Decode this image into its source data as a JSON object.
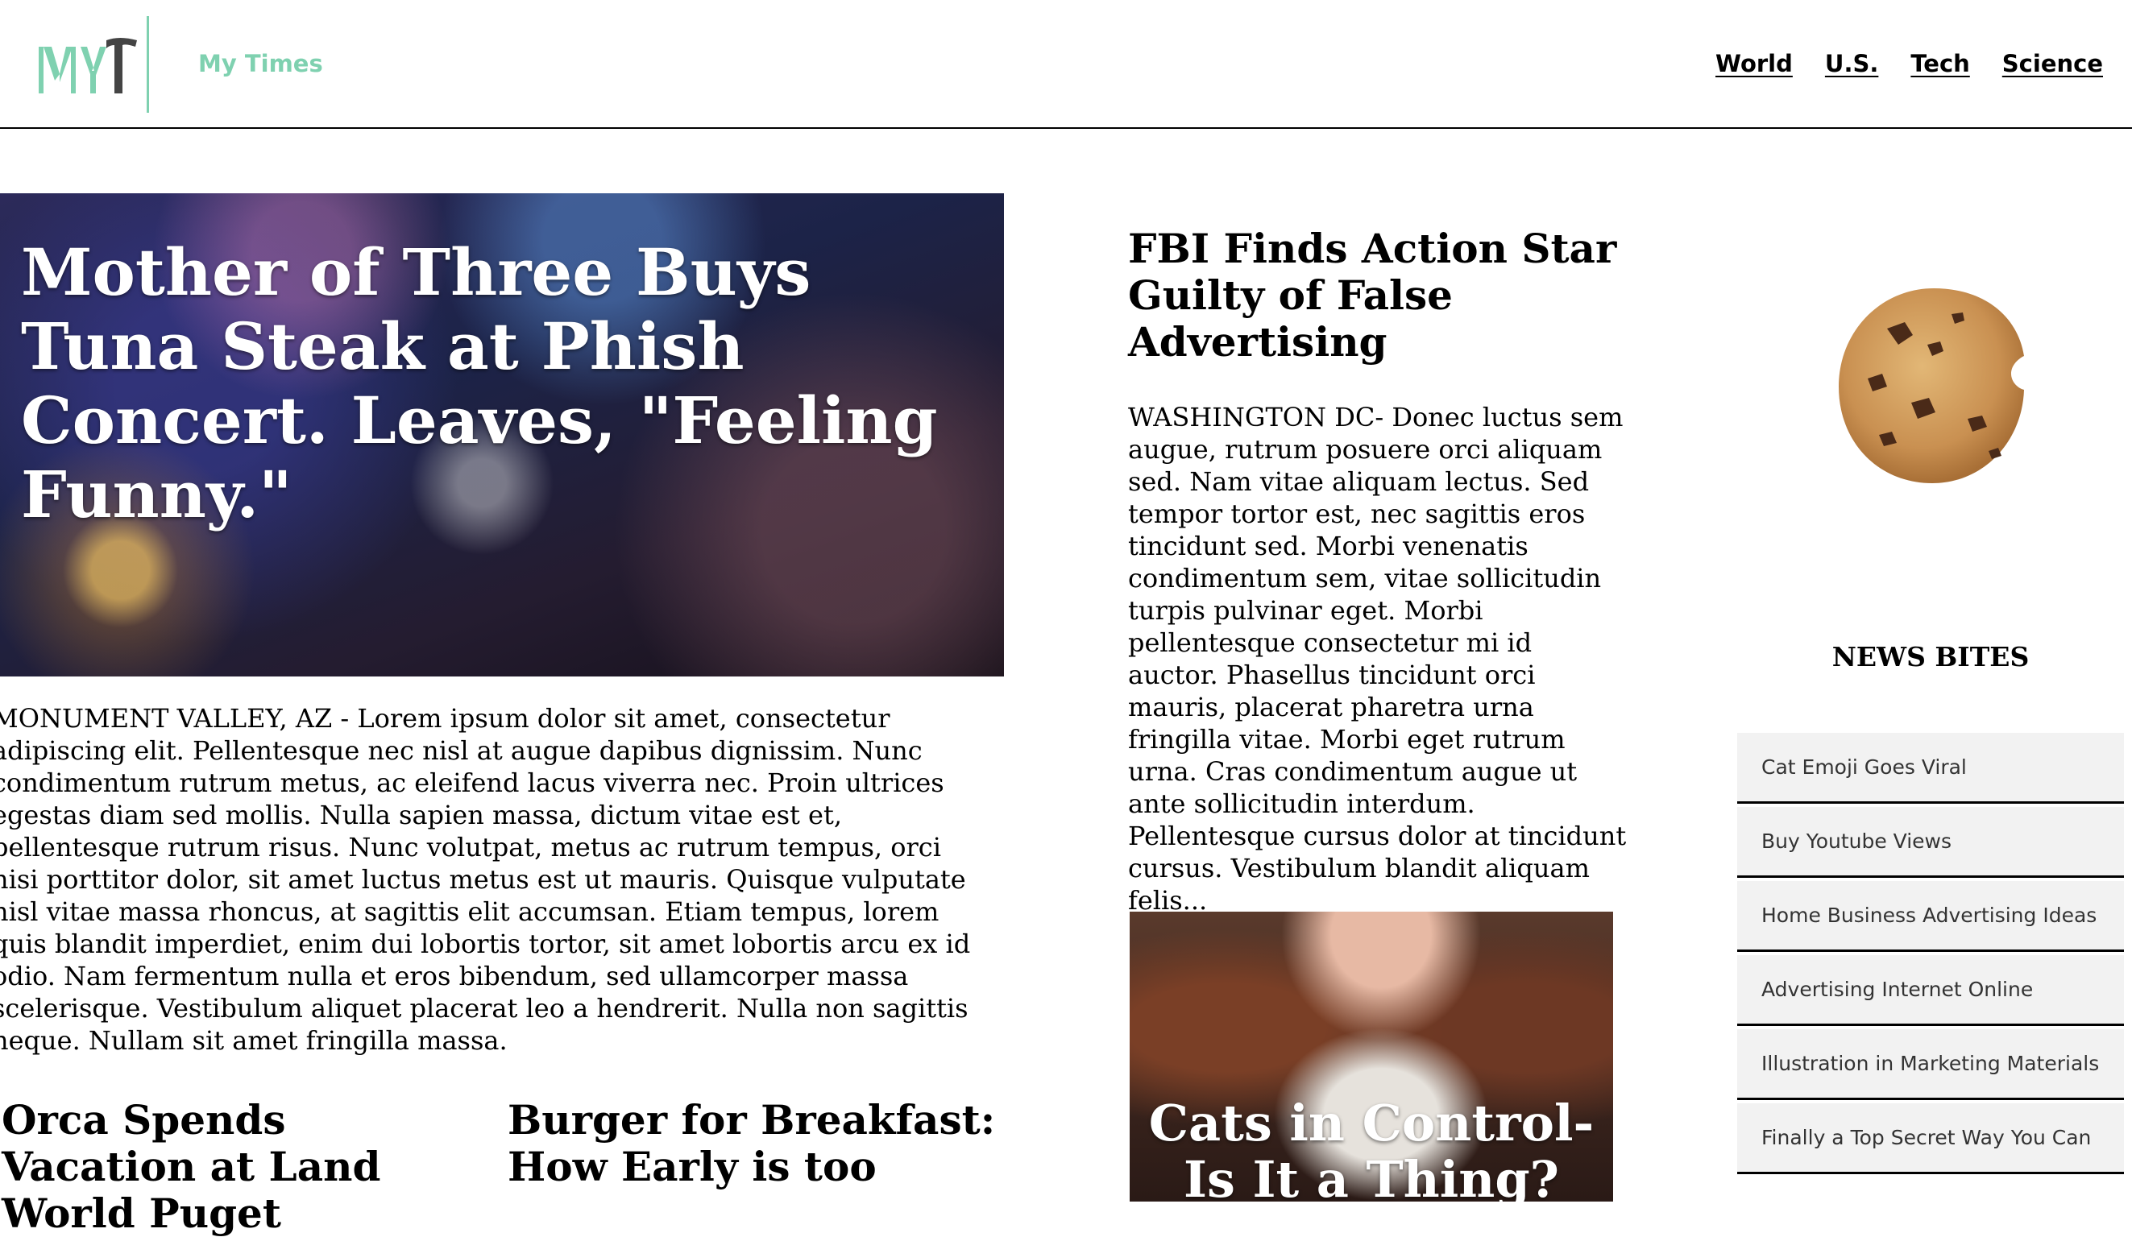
{
  "header": {
    "brand": "My Times",
    "nav": [
      "World",
      "U.S.",
      "Tech",
      "Science"
    ]
  },
  "colors": {
    "accent": "#7fd1b0",
    "divider": "#000000"
  },
  "lead": {
    "title": "Mother of Three Buys Tuna Steak at Phish Concert. Leaves, \"Feeling Funny.\"",
    "body": "MONUMENT VALLEY, AZ - Lorem ipsum dolor sit amet, consectetur adipiscing elit. Pellentesque nec nisl at augue dapibus dignissim. Nunc condimentum rutrum metus, ac eleifend lacus viverra nec. Proin ultrices egestas diam sed mollis. Nulla sapien massa, dictum vitae est et, pellentesque rutrum risus. Nunc volutpat, metus ac rutrum tempus, orci nisi porttitor dolor, sit amet luctus metus est ut mauris. Quisque vulputate nisl vitae massa rhoncus, at sagittis elit accumsan. Etiam tempus, lorem quis blandit imperdiet, enim dui lobortis tortor, sit amet lobortis arcu ex id odio. Nam fermentum nulla et eros bibendum, sed ullamcorper massa scelerisque. Vestibulum aliquet placerat leo a hendrerit. Nulla non sagittis neque. Nullam sit amet fringilla massa."
  },
  "secondary": [
    {
      "title": "Orca Spends Vacation at Land World Puget"
    },
    {
      "title": "Burger for Breakfast: How Early is too"
    }
  ],
  "feature": {
    "title": "FBI Finds Action Star Guilty of False Advertising",
    "body": "WASHINGTON DC- Donec luctus sem augue, rutrum posuere orci aliquam sed. Nam vitae aliquam lectus. Sed tempor tortor est, nec sagittis eros tincidunt sed. Morbi venenatis condimentum sem, vitae sollicitudin turpis pulvinar eget. Morbi pellentesque consectetur mi id auctor. Phasellus tincidunt orci mauris, placerat pharetra urna fringilla vitae. Morbi eget rutrum urna. Cras condimentum augue ut ante sollicitudin interdum. Pellentesque cursus dolor at tincidunt cursus. Vestibulum blandit aliquam felis..."
  },
  "cats": {
    "title": "Cats in Control-Is It a Thing?"
  },
  "sidebar": {
    "title": "NEWS BITES",
    "items": [
      "Cat Emoji Goes Viral",
      "Buy Youtube Views",
      "Home Business Advertising Ideas",
      "Advertising Internet Online",
      "Illustration in Marketing Materials",
      "Finally a Top Secret Way You Can"
    ]
  }
}
